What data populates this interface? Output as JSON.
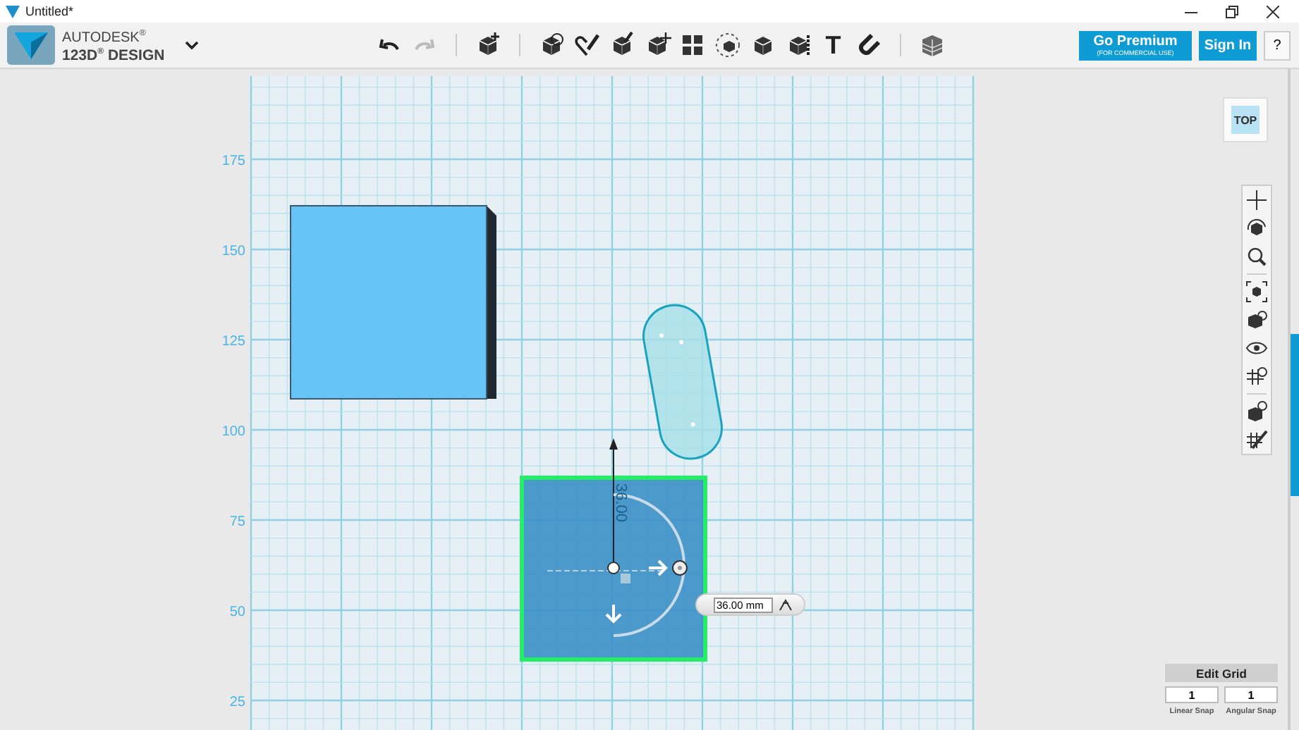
{
  "window": {
    "title": "Untitled*"
  },
  "brand": {
    "line_1": "AUTODESK$^{®}$",
    "line_2": "123D$^{®}$ DESIGN"
  },
  "toolbar": {
    "undo": {
      "disabled": false
    },
    "redo": {
      "disabled": true
    },
    "text_tool": "T"
  },
  "account": {
    "premium_button": "Go Premium",
    "premium_note": "(FOR COMMERCIAL USE)",
    "sign_in": "Sign In",
    "help": "?"
  },
  "view_cube": {
    "face": "TOP"
  },
  "grid": {
    "y_labels": [
      "175",
      "150",
      "125",
      "100",
      "75",
      "50",
      "25"
    ]
  },
  "objects": [
    {
      "kind": "box",
      "selected": false
    },
    {
      "kind": "capsule",
      "selected": false
    },
    {
      "kind": "plate",
      "selected": true
    }
  ],
  "dimension": {
    "label": "36.00",
    "value": "36.00 mm"
  },
  "edit_grid": {
    "button": "Edit Grid",
    "linear_snap": "1",
    "angular_snap": "1",
    "linear_label": "Linear Snap",
    "angular_label": "Angular Snap"
  }
}
